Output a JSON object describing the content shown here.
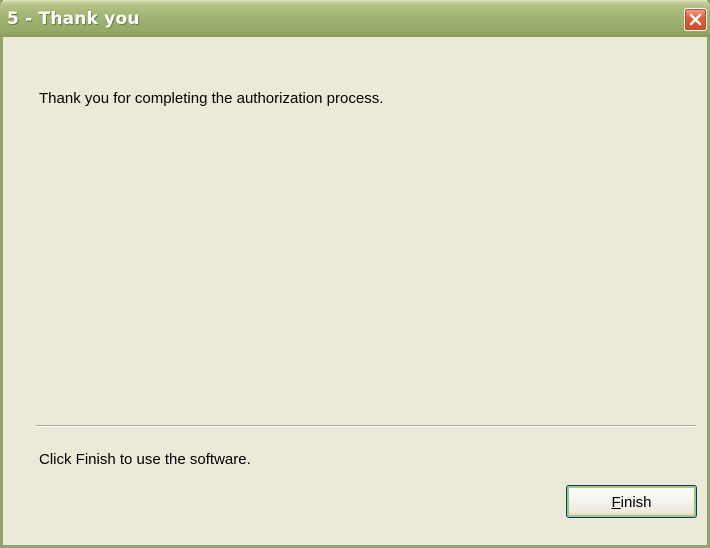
{
  "window": {
    "title": "5 - Thank you"
  },
  "body": {
    "message": "Thank you for completing the authorization process.",
    "footer_text": "Click Finish to use the software."
  },
  "buttons": {
    "finish": {
      "mnemonic": "F",
      "rest": "inish"
    }
  },
  "icons": {
    "close": "close-icon"
  },
  "colors": {
    "titlebar": "#9cb06d",
    "close_button": "#d24a24",
    "background": "#ece9d8",
    "focus_ring": "#a6c77b"
  }
}
